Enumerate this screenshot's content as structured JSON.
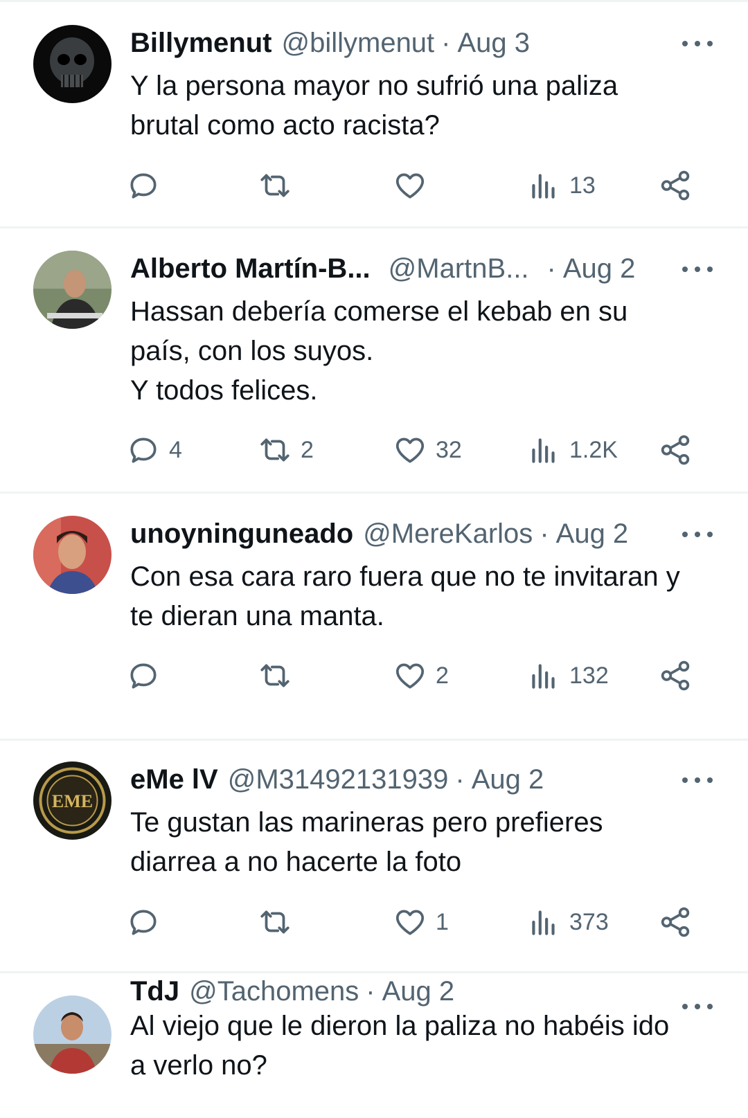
{
  "colors": {
    "text": "#0f1419",
    "secondary": "#536471",
    "divider": "#eff3f4"
  },
  "icons": {
    "reply": "reply-icon",
    "retweet": "retweet-icon",
    "like": "heart-icon",
    "views": "views-icon",
    "share": "share-icon",
    "more": "more-icon"
  },
  "tweets": [
    {
      "name": "Billymenut",
      "handle": "@billymenut",
      "sep": "·",
      "date": "Aug 3",
      "text": "Y la persona mayor no sufrió una paliza\nbrutal como acto racista?",
      "replies": "",
      "retweets": "",
      "likes": "",
      "views": "13"
    },
    {
      "name": "Alberto Martín-B...",
      "handle": "@MartnB...",
      "sep": "·",
      "date": "Aug 2",
      "text": "Hassan debería comerse el kebab en su\npaís, con los suyos.\nY todos felices.",
      "replies": "4",
      "retweets": "2",
      "likes": "32",
      "views": "1.2K"
    },
    {
      "name": "unoyninguneado",
      "handle": "@MereKarlos",
      "sep": "·",
      "date": "Aug 2",
      "text": "Con esa cara raro fuera que no te invitaran y\nte dieran una manta.",
      "replies": "",
      "retweets": "",
      "likes": "2",
      "views": "132"
    },
    {
      "name": "eMe lV",
      "handle": "@M31492131939",
      "sep": "·",
      "date": "Aug 2",
      "text": "Te gustan las marineras pero prefieres\ndiarrea a no hacerte la foto",
      "replies": "",
      "retweets": "",
      "likes": "1",
      "views": "373"
    },
    {
      "name": "TdJ",
      "handle": "@Tachomens",
      "sep": "·",
      "date": "Aug 2",
      "text": "Al viejo que le dieron la paliza no habéis ido\na verlo no?",
      "replies": "",
      "retweets": "",
      "likes": "",
      "views": ""
    }
  ]
}
